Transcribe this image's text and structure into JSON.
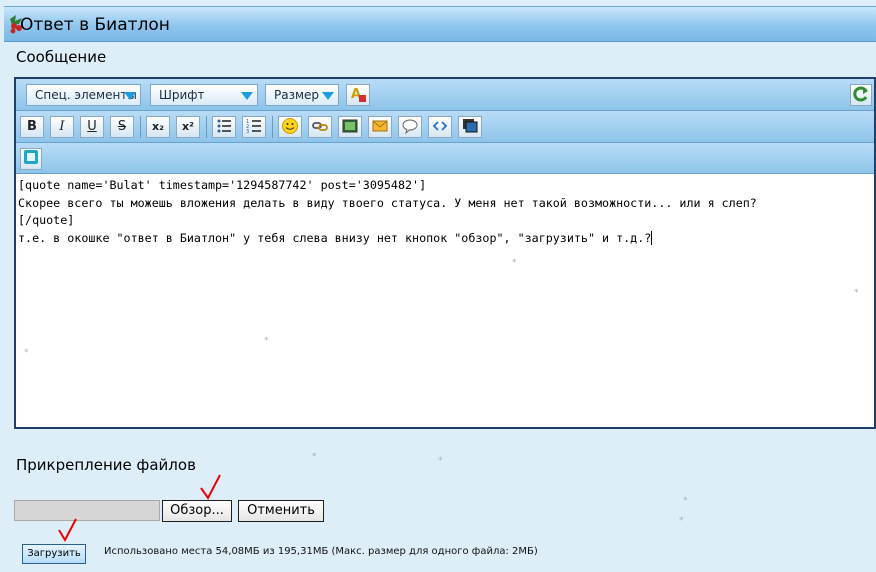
{
  "window": {
    "title": "Ответ в Биатлон"
  },
  "message_section": {
    "label": "Сообщение"
  },
  "toolbar": {
    "special_elements": "Спец. элементы",
    "font": "Шрифт",
    "size": "Размер",
    "format_buttons": [
      {
        "label": "B",
        "name": "bold-button"
      },
      {
        "label": "I",
        "name": "italic-button"
      },
      {
        "label": "U",
        "name": "underline-button"
      },
      {
        "label": "S",
        "name": "strikethrough-button"
      }
    ],
    "script_buttons": [
      {
        "label": "x₂",
        "name": "subscript-button"
      },
      {
        "label": "x²",
        "name": "superscript-button"
      }
    ]
  },
  "editor": {
    "lines": [
      "[quote name='Bulat' timestamp='1294587742' post='3095482']",
      "Скорее всего ты можешь вложения делать в виду твоего статуса. У меня нет такой возможности... или я слеп?",
      "[/quote]",
      "т.е. в окошке \"ответ в Биатлон\" у тебя слева внизу нет кнопок \"обзор\", \"загрузить\" и т.д.?"
    ]
  },
  "attachments": {
    "label": "Прикрепление файлов",
    "browse_button": "Обзор...",
    "cancel_button": "Отменить",
    "upload_button": "Загрузить",
    "usage_text": "Использовано места 54,08МБ из 195,31МБ (Макс. размер для одного файла: 2МБ)"
  },
  "colors": {
    "background": "#ddeef9",
    "toolbar": "#8ec4ea",
    "annotation_check": "#e00000"
  }
}
